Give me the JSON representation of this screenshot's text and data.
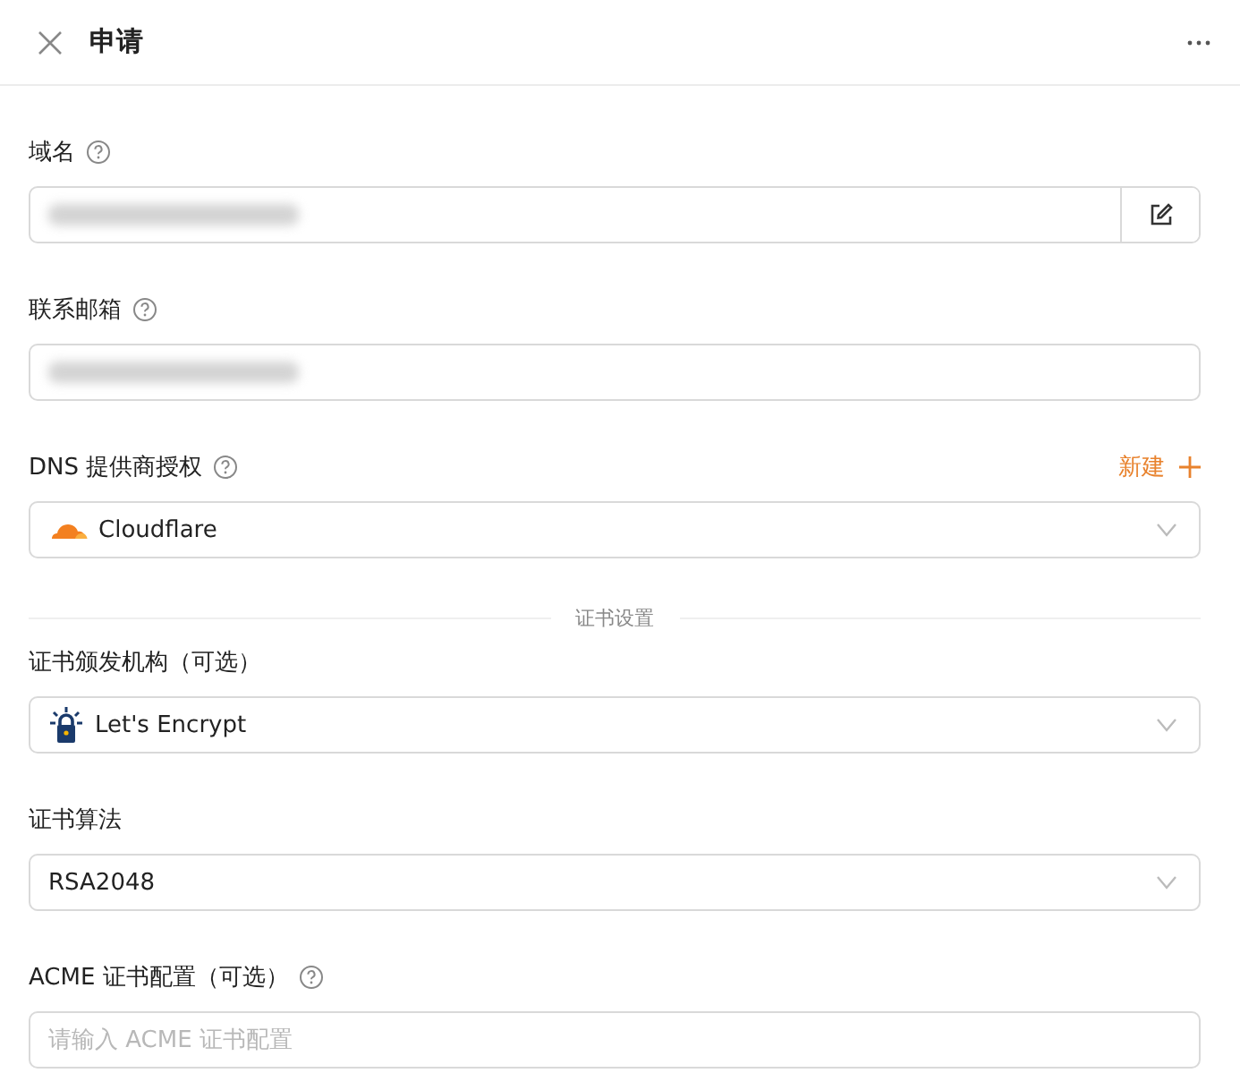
{
  "header": {
    "title": "申请"
  },
  "fields": [
    {
      "kind": "blurred",
      "label": "域名",
      "help": true,
      "edit_button": true
    },
    {
      "kind": "blurred",
      "label": "联系邮箱",
      "help": true,
      "edit_button": false
    },
    {
      "kind": "select",
      "label": "DNS 提供商授权",
      "help": true,
      "action": "新建",
      "value": "Cloudflare"
    },
    {
      "kind": "divider",
      "label": "证书设置"
    },
    {
      "kind": "select",
      "label": "证书颁发机构（可选）",
      "help": false,
      "value": "Let's Encrypt"
    },
    {
      "kind": "select",
      "label": "证书算法",
      "help": false,
      "value": "RSA2048"
    },
    {
      "kind": "input",
      "label": "ACME 证书配置（可选）",
      "help": true,
      "placeholder": "请输入 ACME 证书配置",
      "edit_button": false
    }
  ]
}
